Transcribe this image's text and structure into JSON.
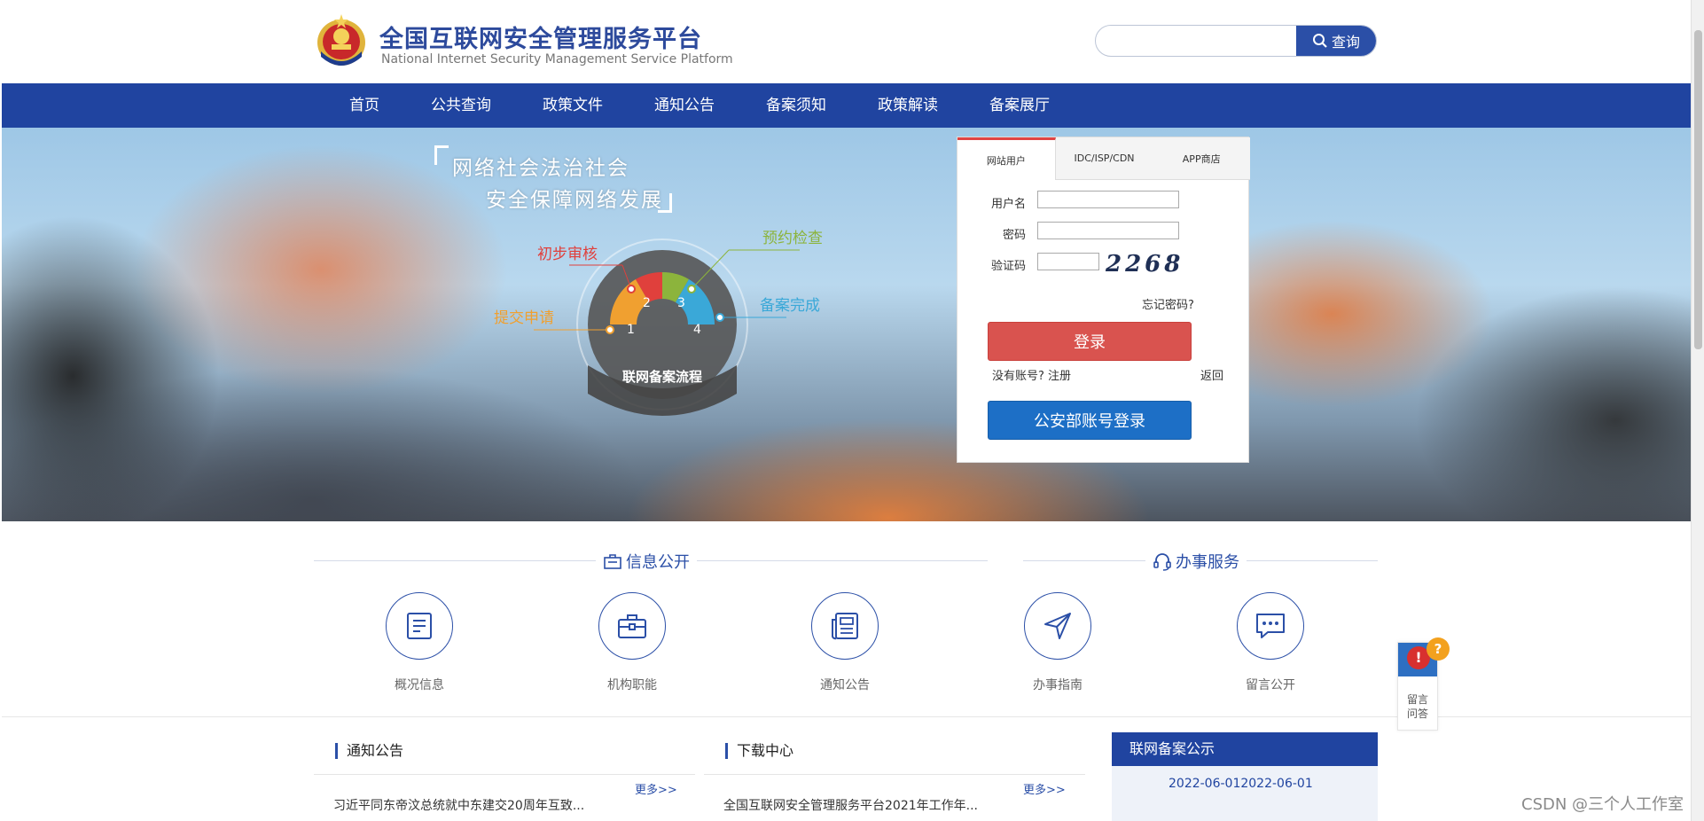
{
  "header": {
    "title_cn": "全国互联网安全管理服务平台",
    "title_en": "National Internet Security Management Service Platform",
    "search_placeholder": "",
    "search_button": "查询"
  },
  "nav": {
    "items": [
      "首页",
      "公共查询",
      "政策文件",
      "通知公告",
      "备案须知",
      "政策解读",
      "备案展厅"
    ]
  },
  "banner": {
    "slogan_line1": "网络社会法治社会",
    "slogan_line2": "安全保障网络发展",
    "flow_title": "联网备案流程",
    "steps": [
      {
        "num": "1",
        "label": "提交申请",
        "color": "#f0a030"
      },
      {
        "num": "2",
        "label": "初步审核",
        "color": "#e0403c"
      },
      {
        "num": "3",
        "label": "预约检查",
        "color": "#8cb43c"
      },
      {
        "num": "4",
        "label": "备案完成",
        "color": "#3aa8d8"
      }
    ]
  },
  "login": {
    "tabs": [
      "网站用户",
      "IDC/ISP/CDN",
      "APP商店"
    ],
    "username_label": "用户名",
    "password_label": "密码",
    "captcha_label": "验证码",
    "captcha_value": "2268",
    "forgot": "忘记密码?",
    "login_button": "登录",
    "register_text": "没有账号? 注册",
    "back": "返回",
    "police_button": "公安部账号登录"
  },
  "sections": {
    "info_title": "信息公开",
    "service_title": "办事服务"
  },
  "services": [
    {
      "label": "概况信息",
      "icon": "document-list-icon"
    },
    {
      "label": "机构职能",
      "icon": "briefcase-icon"
    },
    {
      "label": "通知公告",
      "icon": "newspaper-icon"
    },
    {
      "label": "办事指南",
      "icon": "navigation-arrow-icon"
    },
    {
      "label": "留言公开",
      "icon": "chat-bubble-icon"
    }
  ],
  "notices": {
    "title": "通知公告",
    "more": "更多>>",
    "first_item": "习近平同东帝汶总统就中东建交20周年互致..."
  },
  "downloads": {
    "title": "下载中心",
    "more": "更多>>",
    "first_item": "全国互联网安全管理服务平台2021年工作年..."
  },
  "record": {
    "title": "联网备案公示",
    "first_item": "2022-06-012022-06-01"
  },
  "float_widget": {
    "line1": "留言",
    "line2": "问答"
  },
  "watermark": "CSDN @三个人工作室",
  "colors": {
    "primary": "#2044a0",
    "login_red": "#d9534f",
    "police_blue": "#1d6fc6"
  }
}
